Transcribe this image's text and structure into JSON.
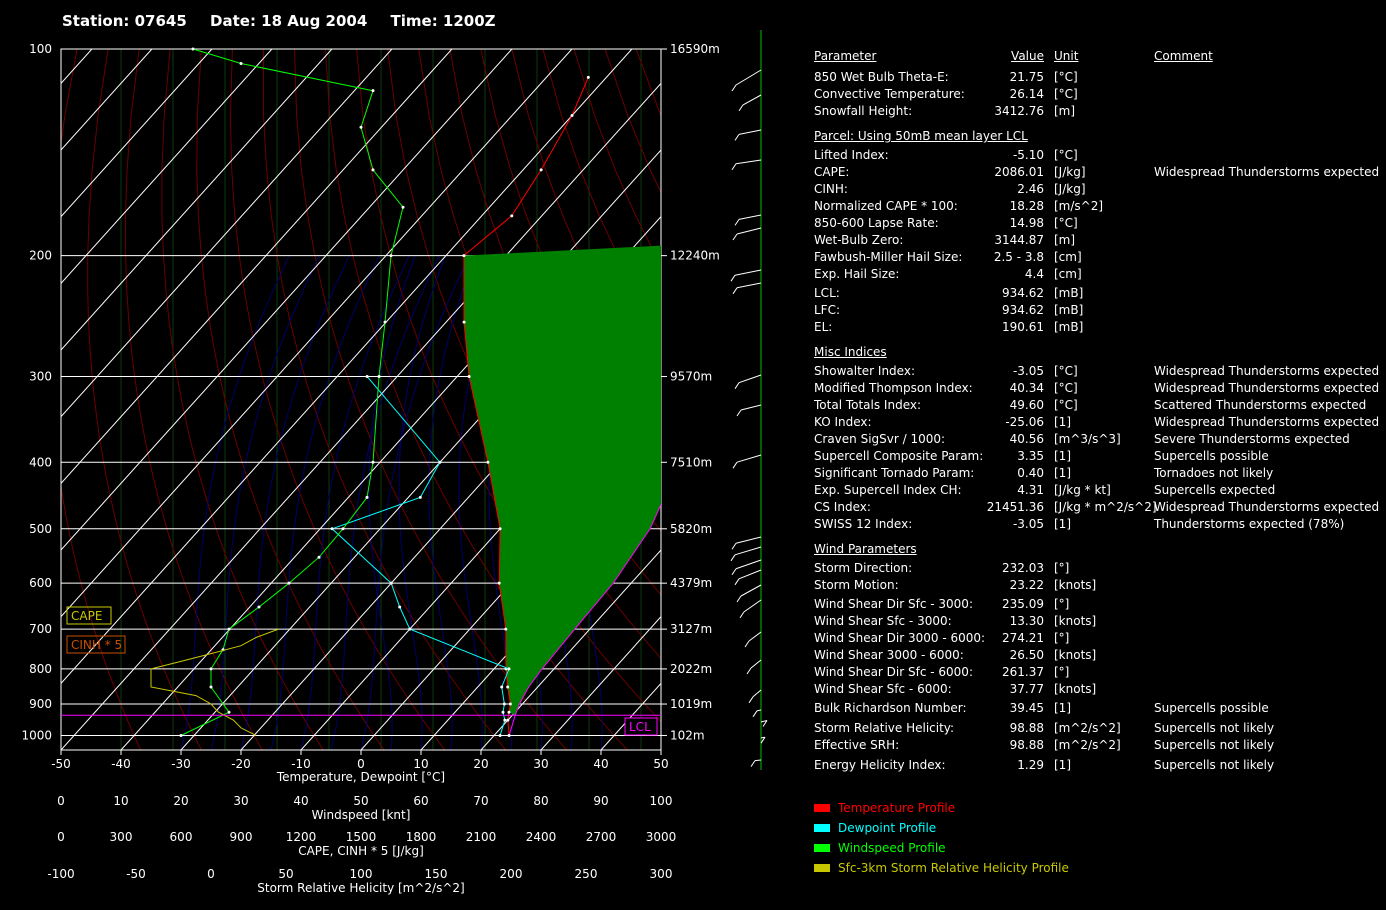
{
  "header": {
    "station": "Station: 07645",
    "date": "Date: 18 Aug 2004",
    "time": "Time: 1200Z"
  },
  "chart_data": {
    "type": "line",
    "title": "",
    "xlabel": "Temperature, Dewpoint [°C]",
    "ylabel": "",
    "pressure_scale": "log",
    "pressure_range": [
      100,
      1050
    ],
    "temp_range": [
      -50,
      50
    ],
    "pressure_levels": [
      100,
      200,
      300,
      400,
      500,
      600,
      700,
      800,
      900,
      1000
    ],
    "height_labels": [
      {
        "p": 100,
        "h": "16590m"
      },
      {
        "p": 200,
        "h": "12240m"
      },
      {
        "p": 300,
        "h": "9570m"
      },
      {
        "p": 400,
        "h": "7510m"
      },
      {
        "p": 500,
        "h": "5820m"
      },
      {
        "p": 600,
        "h": "4379m"
      },
      {
        "p": 700,
        "h": "3127m"
      },
      {
        "p": 800,
        "h": "2022m"
      },
      {
        "p": 900,
        "h": "1019m"
      },
      {
        "p": 1000,
        "h": "102m"
      }
    ],
    "temp_ticks": [
      -50,
      -40,
      -30,
      -20,
      -10,
      0,
      10,
      20,
      30,
      40,
      50
    ],
    "axes": [
      {
        "label": "Windspeed [knt]",
        "ticks": [
          "0",
          "10",
          "20",
          "30",
          "40",
          "50",
          "60",
          "70",
          "80",
          "90",
          "100"
        ]
      },
      {
        "label": "CAPE, CINH * 5 [J/kg]",
        "ticks": [
          "0",
          "300",
          "600",
          "900",
          "1200",
          "1500",
          "1800",
          "2100",
          "2400",
          "2700",
          "3000"
        ]
      },
      {
        "label": "Storm Relative Helicity [m^2/s^2]",
        "ticks": [
          "-100",
          "-50",
          "0",
          "50",
          "100",
          "150",
          "200",
          "250",
          "300"
        ]
      }
    ],
    "series": [
      {
        "name": "Temperature Profile",
        "color": "#ff0000",
        "points": [
          [
            1000,
            22.5
          ],
          [
            950,
            20
          ],
          [
            925,
            19
          ],
          [
            900,
            18
          ],
          [
            850,
            15
          ],
          [
            800,
            12
          ],
          [
            700,
            6
          ],
          [
            600,
            -2
          ],
          [
            500,
            -10
          ],
          [
            400,
            -22
          ],
          [
            300,
            -38
          ],
          [
            250,
            -47
          ],
          [
            200,
            -57
          ],
          [
            175,
            -55
          ],
          [
            150,
            -57
          ],
          [
            125,
            -60
          ],
          [
            110,
            -63
          ]
        ]
      },
      {
        "name": "Dewpoint Profile",
        "color": "#00ffff",
        "points": [
          [
            1000,
            21
          ],
          [
            950,
            19.5
          ],
          [
            925,
            18
          ],
          [
            900,
            17
          ],
          [
            850,
            14
          ],
          [
            800,
            12.5
          ],
          [
            700,
            -10
          ],
          [
            650,
            -15
          ],
          [
            600,
            -20
          ],
          [
            500,
            -38
          ],
          [
            450,
            -28
          ],
          [
            400,
            -30
          ],
          [
            300,
            -55
          ]
        ]
      },
      {
        "name": "Windspeed Profile",
        "color": "#00ff00",
        "points": [
          [
            1000,
            20
          ],
          [
            925,
            28
          ],
          [
            850,
            25
          ],
          [
            800,
            25
          ],
          [
            750,
            27
          ],
          [
            700,
            28
          ],
          [
            650,
            33
          ],
          [
            600,
            38
          ],
          [
            550,
            43
          ],
          [
            500,
            47
          ],
          [
            450,
            51
          ],
          [
            400,
            52
          ],
          [
            300,
            53
          ],
          [
            250,
            54
          ],
          [
            200,
            55
          ],
          [
            170,
            57
          ],
          [
            150,
            52
          ],
          [
            130,
            50
          ],
          [
            115,
            52
          ],
          [
            105,
            30
          ],
          [
            100,
            22
          ]
        ]
      },
      {
        "name": "Sfc-3km Storm Relative Helicity Profile",
        "color": "#c8c800",
        "points": [
          [
            1000,
            30
          ],
          [
            975,
            20
          ],
          [
            950,
            15
          ],
          [
            925,
            5
          ],
          [
            900,
            0
          ],
          [
            875,
            -10
          ],
          [
            850,
            -40
          ],
          [
            800,
            -40
          ],
          [
            780,
            -20
          ],
          [
            760,
            0
          ],
          [
            740,
            20
          ],
          [
            720,
            30
          ],
          [
            700,
            45
          ]
        ]
      }
    ],
    "parcel_profile": [
      [
        1000,
        22.5
      ],
      [
        934.62,
        20.5
      ],
      [
        900,
        19.5
      ],
      [
        850,
        18.5
      ],
      [
        800,
        18
      ],
      [
        700,
        17.5
      ],
      [
        600,
        17
      ],
      [
        500,
        15
      ],
      [
        400,
        10
      ],
      [
        300,
        2
      ],
      [
        250,
        -3
      ],
      [
        200,
        -10
      ],
      [
        190.61,
        -12
      ],
      [
        150,
        -15
      ],
      [
        125,
        -17
      ],
      [
        100,
        -20
      ]
    ],
    "cape_label": "CAPE",
    "cinh_label": "CINH * 5",
    "lcl_label": "LCL",
    "lcl_pressure": 934.62
  },
  "table": {
    "header": {
      "parameter": "Parameter",
      "value": "Value",
      "unit": "Unit",
      "comment": "Comment"
    },
    "sections": [
      {
        "title": "",
        "rows": [
          [
            "850 Wet Bulb Theta-E:",
            "21.75",
            "[°C]",
            ""
          ],
          [
            "Convective Temperature:",
            "26.14",
            "[°C]",
            ""
          ],
          [
            "Snowfall Height:",
            "3412.76",
            "[m]",
            ""
          ]
        ]
      },
      {
        "title": "Parcel: Using 50mB mean layer LCL",
        "rows": [
          [
            "Lifted Index:",
            "-5.10",
            "[°C]",
            ""
          ],
          [
            "CAPE:",
            "2086.01",
            "[J/kg]",
            "Widespread Thunderstorms expected"
          ],
          [
            "CINH:",
            "2.46",
            "[J/kg]",
            ""
          ],
          [
            "Normalized CAPE * 100:",
            "18.28",
            "[m/s^2]",
            ""
          ],
          [
            "850-600 Lapse Rate:",
            "14.98",
            "[°C]",
            ""
          ],
          [
            "Wet-Bulb Zero:",
            "3144.87",
            "[m]",
            ""
          ],
          [
            "Fawbush-Miller Hail Size:",
            "2.5 - 3.8",
            "[cm]",
            ""
          ],
          [
            "Exp. Hail Size:",
            "4.4",
            "[cm]",
            ""
          ],
          [
            "LCL:",
            "934.62",
            "[mB]",
            ""
          ],
          [
            "LFC:",
            "934.62",
            "[mB]",
            ""
          ],
          [
            "EL:",
            "190.61",
            "[mB]",
            ""
          ]
        ]
      },
      {
        "title": "Misc Indices",
        "rows": [
          [
            "Showalter Index:",
            "-3.05",
            "[°C]",
            "Widespread Thunderstorms expected"
          ],
          [
            "Modified Thompson Index:",
            "40.34",
            "[°C]",
            "Widespread Thunderstorms expected"
          ],
          [
            "Total Totals Index:",
            "49.60",
            "[°C]",
            "Scattered Thunderstorms expected"
          ],
          [
            "KO Index:",
            "-25.06",
            "[1]",
            "Widespread Thunderstorms expected"
          ],
          [
            "Craven SigSvr / 1000:",
            "40.56",
            "[m^3/s^3]",
            "Severe Thunderstorms expected"
          ],
          [
            "Supercell Composite Param:",
            "3.35",
            "[1]",
            "Supercells possible"
          ],
          [
            "Significant Tornado Param:",
            "0.40",
            "[1]",
            "Tornadoes not likely"
          ],
          [
            "Exp. Supercell Index CH:",
            "4.31",
            "[J/kg * kt]",
            "Supercells expected"
          ],
          [
            "CS Index:",
            "21451.36",
            "[J/kg * m^2/s^2]",
            "Widespread Thunderstorms expected"
          ],
          [
            "SWISS 12 Index:",
            "-3.05",
            "[1]",
            "Thunderstorms expected (78%)"
          ]
        ]
      },
      {
        "title": "Wind Parameters",
        "rows": [
          [
            "Storm Direction:",
            "232.03",
            "[°]",
            ""
          ],
          [
            "Storm Motion:",
            "23.22",
            "[knots]",
            ""
          ],
          [
            "Wind Shear Dir Sfc - 3000:",
            "235.09",
            "[°]",
            ""
          ],
          [
            "Wind Shear Sfc - 3000:",
            "13.30",
            "[knots]",
            ""
          ],
          [
            "Wind Shear Dir 3000 - 6000:",
            "274.21",
            "[°]",
            ""
          ],
          [
            "Wind Shear 3000 - 6000:",
            "26.50",
            "[knots]",
            ""
          ],
          [
            "Wind Shear Dir Sfc - 6000:",
            "261.37",
            "[°]",
            ""
          ],
          [
            "Wind Shear Sfc - 6000:",
            "37.77",
            "[knots]",
            ""
          ],
          [
            "Bulk Richardson Number:",
            "39.45",
            "[1]",
            "Supercells possible"
          ],
          [
            "Storm Relative Helicity:",
            "98.88",
            "[m^2/s^2]",
            "Supercells not likely"
          ],
          [
            "Effective SRH:",
            "98.88",
            "[m^2/s^2]",
            "Supercells not likely"
          ],
          [
            "Energy Helicity Index:",
            "1.29",
            "[1]",
            "Supercells not likely"
          ]
        ]
      }
    ]
  },
  "legend": [
    {
      "label": "Temperature Profile",
      "color": "#ff0000"
    },
    {
      "label": "Dewpoint Profile",
      "color": "#00ffff"
    },
    {
      "label": "Windspeed Profile",
      "color": "#00ff00"
    },
    {
      "label": "Sfc-3km Storm Relative Helicity Profile",
      "color": "#c8c800"
    }
  ]
}
